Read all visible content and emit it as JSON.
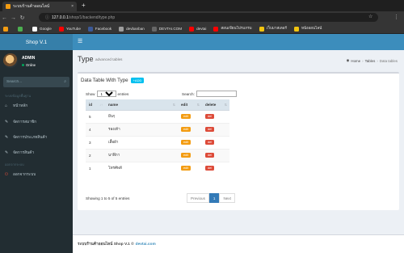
{
  "browser": {
    "tab_title": "ระบบร้านค้าออนไลน์",
    "tab_close": "×",
    "new_tab": "+",
    "url_host": "127.0.0.1",
    "url_path": "/shop/1/backend/type.php",
    "bookmarks": [
      {
        "label": "",
        "icon_color": "#f39c12"
      },
      {
        "label": "",
        "icon_color": "#4caf50"
      },
      {
        "label": "Google",
        "icon_color": "#ffffff"
      },
      {
        "label": "YouTube",
        "icon_color": "#ff0000"
      },
      {
        "label": "Facebook",
        "icon_color": "#3b5998"
      },
      {
        "label": "devbanban",
        "icon_color": "#9e9e9e"
      },
      {
        "label": "DEVTAI.COM",
        "icon_color": "#666666"
      },
      {
        "label": "devtai",
        "icon_color": "#ff0000"
      },
      {
        "label": "สอนเขียนโปรแกรม",
        "icon_color": "#ff0000"
      },
      {
        "label": "เว็บมาสเตอร์",
        "icon_color": "#f1c40f"
      },
      {
        "label": "หนังออนไลน์",
        "icon_color": "#f1c40f"
      }
    ]
  },
  "app": {
    "logo": "Shop V.1",
    "user": {
      "name": "ADMIN",
      "status": "Online"
    },
    "search_placeholder": "Search...",
    "sidebar": {
      "section1": "ระบบข้อมูลพื้นฐาน",
      "items": [
        {
          "label": "หน้าหลัก",
          "icon": "home-icon"
        },
        {
          "label": "จัดการสมาชิก",
          "icon": "edit-icon"
        },
        {
          "label": "จัดการประเภทสินค้า",
          "icon": "edit-icon"
        },
        {
          "label": "จัดการสินค้า",
          "icon": "edit-icon"
        }
      ],
      "section2": "ออกจากระบบ",
      "logout": "ออกจากระบบ"
    },
    "header": {
      "title": "Type",
      "subtitle": "advanced tables",
      "breadcrumb": [
        "Home",
        "Tables",
        "Data tables"
      ]
    },
    "box": {
      "title": "Data Table With Type",
      "add_label": "+ADD",
      "show_label": "Show",
      "show_value": "10",
      "entries_label": "entries",
      "search_label": "Search:"
    },
    "table": {
      "columns": [
        "id",
        "name",
        "edit",
        "delete"
      ],
      "rows": [
        {
          "id": "5",
          "name": "ยีนๆ"
        },
        {
          "id": "4",
          "name": "รองเท้า"
        },
        {
          "id": "3",
          "name": "เสื้อผ้า"
        },
        {
          "id": "2",
          "name": "นาฬิกา"
        },
        {
          "id": "1",
          "name": "โทรศัพท์"
        }
      ],
      "edit_label": "edit",
      "delete_label": "del"
    },
    "info": "Showing 1 to 5 of 5 entries",
    "pagination": {
      "previous": "Previous",
      "page": "1",
      "next": "Next"
    },
    "footer": {
      "text": "ระบบร้านค้าออนไลน์ Shop V.1 ©",
      "link": "devtai.com"
    }
  },
  "colors": {
    "primary": "#3c8dbc",
    "sidebar": "#222d32",
    "edit": "#f39c12",
    "delete": "#dd4b39",
    "add": "#00c0ef"
  }
}
